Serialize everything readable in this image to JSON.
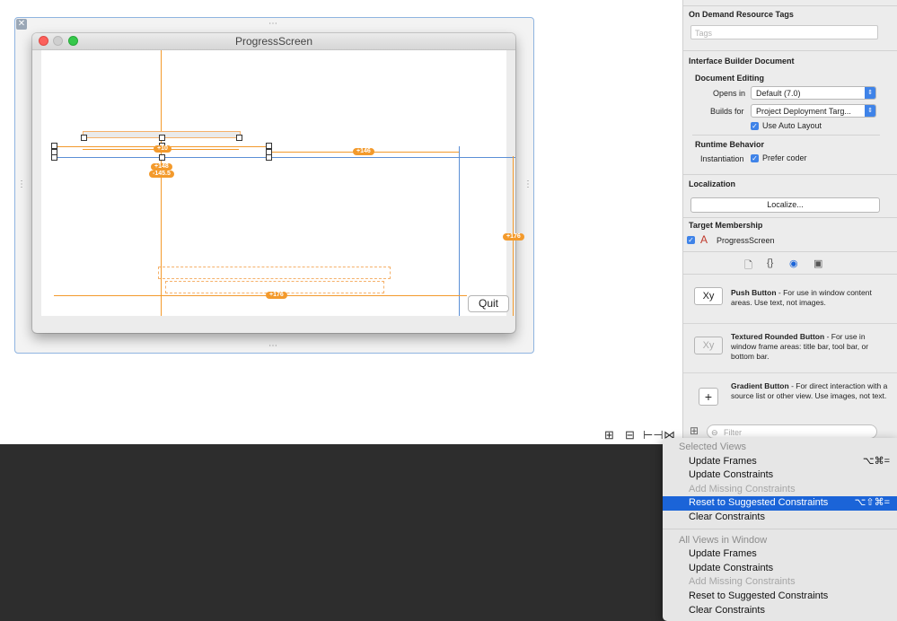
{
  "canvas": {
    "window_title": "ProgressScreen",
    "scene_close_glyph": "✕",
    "quit_button": "Quit",
    "constraint_badges": {
      "center_y": "+148",
      "left_offset": "-145.5",
      "small_width": "+10",
      "right_width": "+146",
      "vertical": "+176",
      "bottom_width": "+176"
    },
    "bottom_icons": [
      {
        "name": "stack-icon",
        "glyph": "⊞"
      },
      {
        "name": "align-icon",
        "glyph": "⊟"
      },
      {
        "name": "pin-icon",
        "glyph": "⊢⊣"
      },
      {
        "name": "resolve-icon",
        "glyph": "⋈"
      }
    ]
  },
  "inspector": {
    "on_demand": {
      "title": "On Demand Resource Tags",
      "tags_placeholder": "Tags"
    },
    "ib_document": {
      "title": "Interface Builder Document",
      "editing_title": "Document Editing",
      "opens_in_label": "Opens in",
      "opens_in_value": "Default (7.0)",
      "builds_for_label": "Builds for",
      "builds_for_value": "Project Deployment Targ...",
      "auto_layout_label": "Use Auto Layout",
      "runtime_title": "Runtime Behavior",
      "instantiation_label": "Instantiation",
      "prefer_coder_label": "Prefer coder"
    },
    "localization": {
      "title": "Localization",
      "button": "Localize..."
    },
    "target_membership": {
      "title": "Target Membership",
      "target": "ProgressScreen"
    },
    "library_tabs": [
      {
        "name": "file-template-icon",
        "glyph": "🗋"
      },
      {
        "name": "code-snippet-icon",
        "glyph": "{}"
      },
      {
        "name": "object-library-icon",
        "glyph": "◉"
      },
      {
        "name": "media-library-icon",
        "glyph": "▣"
      }
    ],
    "library": [
      {
        "icon": "Xy",
        "title": "Push Button",
        "desc": " - For use in window content areas. Use text, not images."
      },
      {
        "icon": "Xy",
        "title": "Textured Rounded Button",
        "desc": " - For use in window frame areas: title bar, tool bar, or bottom bar."
      },
      {
        "icon": "+",
        "title": "Gradient Button",
        "desc": " - For direct interaction with a source list or other view. Use images, not text."
      }
    ],
    "filter_placeholder": "Filter"
  },
  "menu": {
    "section1_header": "Selected Views",
    "section1": [
      {
        "label": "Update Frames",
        "shortcut": "⌥⌘=",
        "state": "normal"
      },
      {
        "label": "Update Constraints",
        "shortcut": "",
        "state": "normal"
      },
      {
        "label": "Add Missing Constraints",
        "shortcut": "",
        "state": "disabled"
      },
      {
        "label": "Reset to Suggested Constraints",
        "shortcut": "⌥⇧⌘=",
        "state": "highlighted"
      },
      {
        "label": "Clear Constraints",
        "shortcut": "",
        "state": "normal"
      }
    ],
    "section2_header": "All Views in Window",
    "section2": [
      {
        "label": "Update Frames",
        "shortcut": "",
        "state": "normal"
      },
      {
        "label": "Update Constraints",
        "shortcut": "",
        "state": "normal"
      },
      {
        "label": "Add Missing Constraints",
        "shortcut": "",
        "state": "disabled"
      },
      {
        "label": "Reset to Suggested Constraints",
        "shortcut": "",
        "state": "normal"
      },
      {
        "label": "Clear Constraints",
        "shortcut": "",
        "state": "normal"
      }
    ]
  },
  "colors": {
    "accent": "#1b64d8",
    "constraint": "#f39a2c",
    "guide": "#5b8fd6"
  }
}
